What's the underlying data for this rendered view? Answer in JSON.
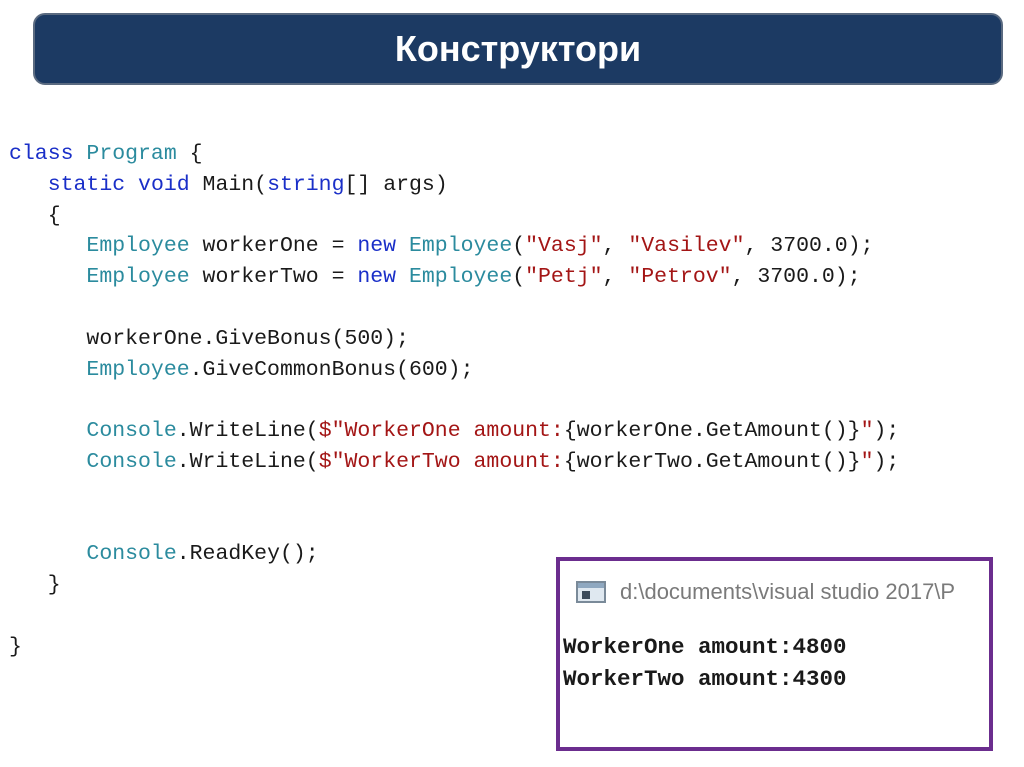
{
  "slide": {
    "title": "Конструктори"
  },
  "colors": {
    "title_background": "#1c3a63",
    "keyword": "#1a2fc8",
    "type": "#2b8b9e",
    "string": "#a31515",
    "console_border": "#6b2d8e"
  },
  "code": {
    "lines": [
      [
        {
          "t": "class",
          "c": "kw"
        },
        {
          "t": " ",
          "c": "plain"
        },
        {
          "t": "Program",
          "c": "type"
        },
        {
          "t": " {",
          "c": "plain"
        }
      ],
      [
        {
          "t": "   ",
          "c": "plain"
        },
        {
          "t": "static",
          "c": "kw"
        },
        {
          "t": " ",
          "c": "plain"
        },
        {
          "t": "void",
          "c": "kw"
        },
        {
          "t": " Main(",
          "c": "plain"
        },
        {
          "t": "string",
          "c": "kw"
        },
        {
          "t": "[] args)",
          "c": "plain"
        }
      ],
      [
        {
          "t": "   {",
          "c": "plain"
        }
      ],
      [
        {
          "t": "      ",
          "c": "plain"
        },
        {
          "t": "Employee",
          "c": "type"
        },
        {
          "t": " workerOne = ",
          "c": "plain"
        },
        {
          "t": "new",
          "c": "kw"
        },
        {
          "t": " ",
          "c": "plain"
        },
        {
          "t": "Employee",
          "c": "type"
        },
        {
          "t": "(",
          "c": "plain"
        },
        {
          "t": "\"Vasj\"",
          "c": "str"
        },
        {
          "t": ", ",
          "c": "plain"
        },
        {
          "t": "\"Vasilev\"",
          "c": "str"
        },
        {
          "t": ", 3700.0);",
          "c": "plain"
        }
      ],
      [
        {
          "t": "      ",
          "c": "plain"
        },
        {
          "t": "Employee",
          "c": "type"
        },
        {
          "t": " workerTwo = ",
          "c": "plain"
        },
        {
          "t": "new",
          "c": "kw"
        },
        {
          "t": " ",
          "c": "plain"
        },
        {
          "t": "Employee",
          "c": "type"
        },
        {
          "t": "(",
          "c": "plain"
        },
        {
          "t": "\"Petj\"",
          "c": "str"
        },
        {
          "t": ", ",
          "c": "plain"
        },
        {
          "t": "\"Petrov\"",
          "c": "str"
        },
        {
          "t": ", 3700.0);",
          "c": "plain"
        }
      ],
      [],
      [
        {
          "t": "      workerOne.GiveBonus(500);",
          "c": "plain"
        }
      ],
      [
        {
          "t": "      ",
          "c": "plain"
        },
        {
          "t": "Employee",
          "c": "type"
        },
        {
          "t": ".GiveCommonBonus(600);",
          "c": "plain"
        }
      ],
      [],
      [
        {
          "t": "      ",
          "c": "plain"
        },
        {
          "t": "Console",
          "c": "type"
        },
        {
          "t": ".WriteLine(",
          "c": "plain"
        },
        {
          "t": "$\"WorkerOne amount:",
          "c": "str"
        },
        {
          "t": "{workerOne.GetAmount()}",
          "c": "plain"
        },
        {
          "t": "\"",
          "c": "str"
        },
        {
          "t": ");",
          "c": "plain"
        }
      ],
      [
        {
          "t": "      ",
          "c": "plain"
        },
        {
          "t": "Console",
          "c": "type"
        },
        {
          "t": ".WriteLine(",
          "c": "plain"
        },
        {
          "t": "$\"WorkerTwo amount:",
          "c": "str"
        },
        {
          "t": "{workerTwo.GetAmount()}",
          "c": "plain"
        },
        {
          "t": "\"",
          "c": "str"
        },
        {
          "t": ");",
          "c": "plain"
        }
      ],
      [],
      [],
      [
        {
          "t": "      ",
          "c": "plain"
        },
        {
          "t": "Console",
          "c": "type"
        },
        {
          "t": ".ReadKey();",
          "c": "plain"
        }
      ],
      [
        {
          "t": "   }",
          "c": "plain"
        }
      ],
      [],
      [
        {
          "t": "}",
          "c": "plain"
        }
      ]
    ]
  },
  "console": {
    "icon": "console-window-icon",
    "title": "d:\\documents\\visual studio 2017\\P",
    "output": [
      "WorkerOne amount:4800",
      "WorkerTwo amount:4300"
    ]
  }
}
